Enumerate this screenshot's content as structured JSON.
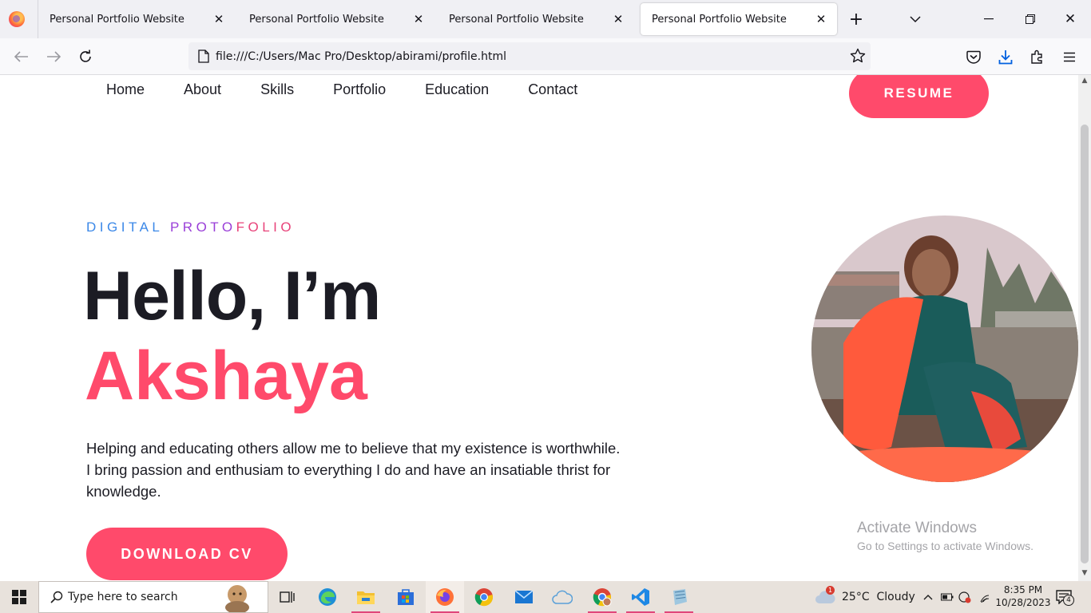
{
  "browser": {
    "tabs": [
      {
        "title": "Personal Portfolio Website"
      },
      {
        "title": "Personal Portfolio Website"
      },
      {
        "title": "Personal Portfolio Website"
      },
      {
        "title": "Personal Portfolio Website"
      }
    ],
    "active_tab": 3,
    "url": "file:///C:/Users/Mac Pro/Desktop/abirami/profile.html"
  },
  "site": {
    "nav": [
      "Home",
      "About",
      "Skills",
      "Portfolio",
      "Education",
      "Contact"
    ],
    "resume_label": "RESUME",
    "tagline_1": "DIGITAL",
    "tagline_2": "PROTO",
    "tagline_3": "FOLIO",
    "greeting": "Hello, I’m",
    "name": "Akshaya",
    "intro": "Helping and educating others allow me to believe that my existence is worthwhile. I bring passion and enthusiam to everything I do and have an insatiable thrist for knowledge.",
    "download_label": "DOWNLOAD CV",
    "accent": "#ff4a6b"
  },
  "watermark": {
    "title": "Activate Windows",
    "subtitle": "Go to Settings to activate Windows."
  },
  "taskbar": {
    "search_placeholder": "Type here to search",
    "weather": "25°C  Cloudy",
    "weather_badge": "1",
    "time": "8:35 PM",
    "date": "10/28/2023",
    "notifications": "4"
  }
}
